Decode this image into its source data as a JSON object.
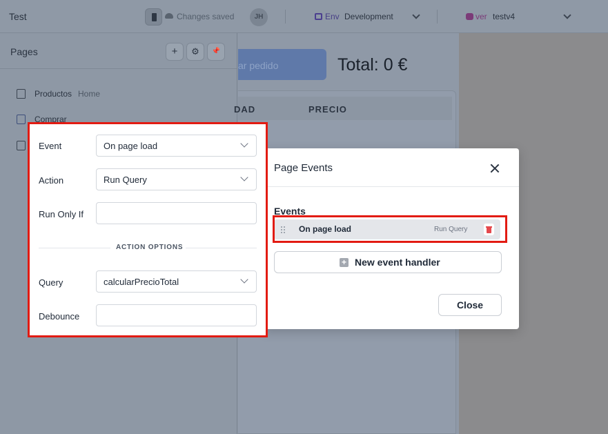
{
  "topbar": {
    "app_name": "Test",
    "saved_status": "Changes saved",
    "avatar_initials": "JH",
    "env_label": "Env",
    "env_value": "Development",
    "version_label": "ver",
    "version_value": "testv4"
  },
  "sidebar": {
    "title": "Pages",
    "actions": [
      {
        "icon": "plus-icon",
        "glyph": "+"
      },
      {
        "icon": "gear-icon",
        "glyph": "⚙"
      },
      {
        "icon": "pin-icon",
        "glyph": "📌"
      }
    ],
    "pages": [
      {
        "label": "Productos",
        "badge": "Home",
        "icon": "home-icon"
      },
      {
        "label": "Comprar",
        "badge": "",
        "icon": "file-icon"
      },
      {
        "label": "",
        "badge": "",
        "icon": "file-icon"
      }
    ]
  },
  "canvas": {
    "button_partial": "ar pedido",
    "total": "Total: 0 €",
    "table_headers": [
      "DAD",
      "PRECIO"
    ]
  },
  "dialog": {
    "title": "Page Events",
    "events_label": "Events",
    "event": {
      "name": "On page load",
      "action": "Run Query"
    },
    "new_handler_label": "New event handler",
    "close_label": "Close"
  },
  "event_config": {
    "event_label": "Event",
    "event_value": "On page load",
    "action_label": "Action",
    "action_value": "Run Query",
    "run_only_if_label": "Run Only If",
    "run_only_if_value": "",
    "section_title": "ACTION OPTIONS",
    "query_label": "Query",
    "query_value": "calcularPrecioTotal",
    "debounce_label": "Debounce",
    "debounce_value": ""
  },
  "colors": {
    "highlight": "#e21b12",
    "delete": "#e5484d",
    "env_accent": "#4b3f8f",
    "version_accent": "#7b3b78"
  }
}
